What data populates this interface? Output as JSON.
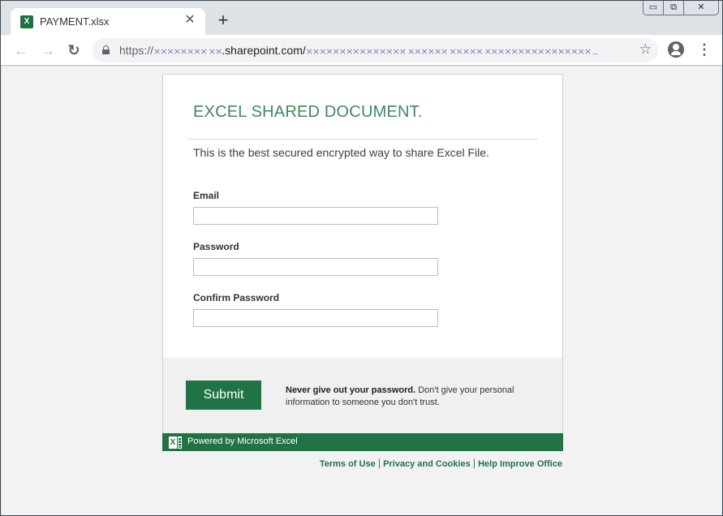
{
  "browser": {
    "tab": {
      "title": "PAYMENT.xlsx",
      "favicon": "excel-icon",
      "close_glyph": "✕"
    },
    "new_tab_glyph": "+",
    "window_controls": {
      "minimize": "▭",
      "maximize": "⧉",
      "close": "✕"
    },
    "nav": {
      "back": "←",
      "forward": "→",
      "reload": "↻"
    },
    "address": {
      "scheme": "https://",
      "obfuscated_prefix": "⨯⨯⨯⨯⨯⨯⨯⨯  ⨯⨯",
      "domain": ".sharepoint.com/",
      "obfuscated_path": "⨯⨯⨯⨯⨯⨯⨯⨯⨯⨯⨯⨯⨯⨯⨯ ⨯⨯⨯⨯⨯⨯ ⨯⨯⨯⨯⨯ ⨯⨯⨯⨯⨯⨯⨯⨯⨯⨯⨯⨯⨯⨯⨯⨯ ...",
      "bookmark_glyph": "☆",
      "menu_glyph": "⋮"
    }
  },
  "page": {
    "title": "EXCEL SHARED DOCUMENT.",
    "subtitle": "This is the best secured encrypted way to share Excel File.",
    "fields": [
      {
        "label": "Email",
        "value": "",
        "placeholder": ""
      },
      {
        "label": "Password",
        "value": "",
        "placeholder": ""
      },
      {
        "label": "Confirm Password",
        "value": "",
        "placeholder": ""
      }
    ],
    "submit_label": "Submit",
    "warning_bold": "Never give out your password.",
    "warning_text": " Don't give your personal information to someone you don't trust.",
    "powered_by": "Powered by Microsoft Excel",
    "excel_icon_letter": "X",
    "footer_links": [
      "Terms of Use",
      "Privacy and Cookies",
      "Help Improve Office"
    ],
    "footer_separator": "|"
  },
  "colors": {
    "brand_green": "#217346",
    "title_green": "#3f8a5f",
    "footer_bg": "#f0f0f0",
    "page_bg": "#f2f2f2"
  }
}
